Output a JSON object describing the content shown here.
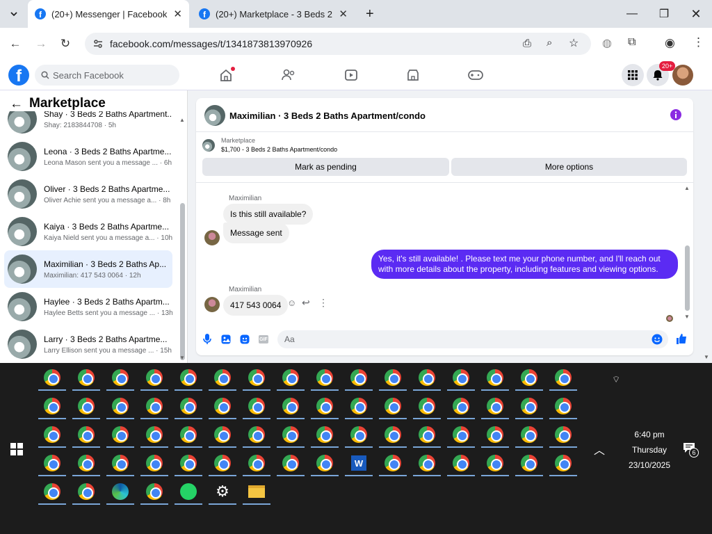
{
  "browser": {
    "tabs": [
      {
        "title": "(20+) Messenger | Facebook",
        "active": true
      },
      {
        "title": "(20+) Marketplace - 3 Beds 2 Ba",
        "active": false
      }
    ],
    "url": "facebook.com/messages/t/1341873813970926"
  },
  "header": {
    "search_placeholder": "Search Facebook",
    "notification_badge": "20+"
  },
  "left": {
    "title": "Marketplace",
    "conversations": [
      {
        "title": "Shay · 3 Beds 2 Baths Apartment...",
        "preview": "Shay: 2183844708 · 5h",
        "selected": false
      },
      {
        "title": "Leona · 3 Beds 2 Baths Apartme...",
        "preview": "Leona Mason sent you a message ... · 6h",
        "selected": false
      },
      {
        "title": "Oliver · 3 Beds 2 Baths Apartme...",
        "preview": "Oliver Achie sent you a message a... · 8h",
        "selected": false
      },
      {
        "title": "Kaiya · 3 Beds 2 Baths Apartme...",
        "preview": "Kaiya Nield sent you a message a... · 10h",
        "selected": false
      },
      {
        "title": "Maximilian · 3 Beds 2 Baths Ap...",
        "preview": "Maximilian: 417 543 0064 · 12h",
        "selected": true
      },
      {
        "title": "Haylee · 3 Beds 2 Baths Apartm...",
        "preview": "Haylee Betts sent you a message ... · 13h",
        "selected": false
      },
      {
        "title": "Larry · 3 Beds 2 Baths Apartme...",
        "preview": "Larry Ellison sent you a message ... · 15h",
        "selected": false
      }
    ]
  },
  "chat": {
    "title": "Maximilian · 3 Beds 2 Baths Apartment/condo",
    "listing_label": "Marketplace",
    "listing_detail": "$1,700 - 3 Beds 2 Baths Apartment/condo",
    "mark_pending": "Mark as pending",
    "more_options": "More options",
    "messages": [
      {
        "sender": "Maximilian",
        "text": "Is this still available?"
      },
      {
        "sender": "",
        "text": "Message sent"
      },
      {
        "sender": "me",
        "text": "Yes, it's still available! . Please text me your phone number, and I'll reach out with more details about the property, including features and viewing options."
      },
      {
        "sender": "Maximilian",
        "text": "417 543 0064"
      }
    ],
    "composer_placeholder": "Aa"
  },
  "taskbar": {
    "time": "6:40 pm",
    "day": "Thursday",
    "date": "23/10/2025",
    "notification_count": "6"
  },
  "colors": {
    "fb_blue": "#1877f2",
    "own_bubble": "#5b2bf3",
    "selected_row": "#e7f0fe"
  }
}
